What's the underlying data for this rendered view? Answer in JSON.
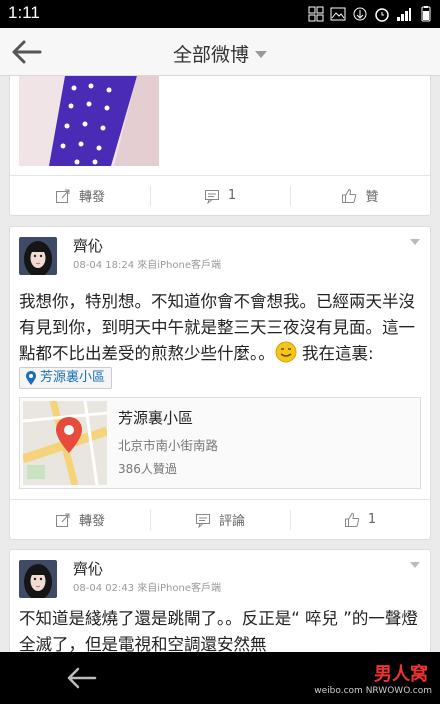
{
  "status_bar": {
    "time": "1:11",
    "icons": [
      "grid-icon",
      "image-icon",
      "data-sync-icon",
      "alarm-icon",
      "signal-icon",
      "battery-icon"
    ]
  },
  "header": {
    "title": "全部微博"
  },
  "post1": {
    "actions": {
      "repost": "轉發",
      "comment": "1",
      "like": "贊"
    }
  },
  "post2": {
    "user": "齊伈",
    "meta": "08-04 18:24   來自iPhone客戶端",
    "text": "我想你，特別想。不知道你會不會想我。已經兩天半沒有見到你，到明天中午就是整三天三夜沒有見面。這一點都不比出差受的煎熬少些什麼。。",
    "text_after_emoji": " 我在這裏:",
    "location_chip": "芳源裏小區",
    "place": {
      "name": "芳源裏小區",
      "address": "北京市南小街南路",
      "count": "386人贊過"
    },
    "actions": {
      "repost": "轉發",
      "comment": "評論",
      "like": "1"
    }
  },
  "post3": {
    "user": "齊伈",
    "meta": "08-04 02:43   來自iPhone客戶端",
    "text": "不知道是綫燒了還是跳閘了。。反正是“ 啐兒 ”的一聲燈全滅了，但是電視和空調還安然無"
  },
  "watermark": {
    "site": "男人窝",
    "url": "NRWOWO.com",
    "handle": "weibo.com"
  },
  "colors": {
    "link_blue": "#1b6fb8",
    "map_pin": "#e64b3c",
    "thumb_purple": "#4a2bb6"
  }
}
